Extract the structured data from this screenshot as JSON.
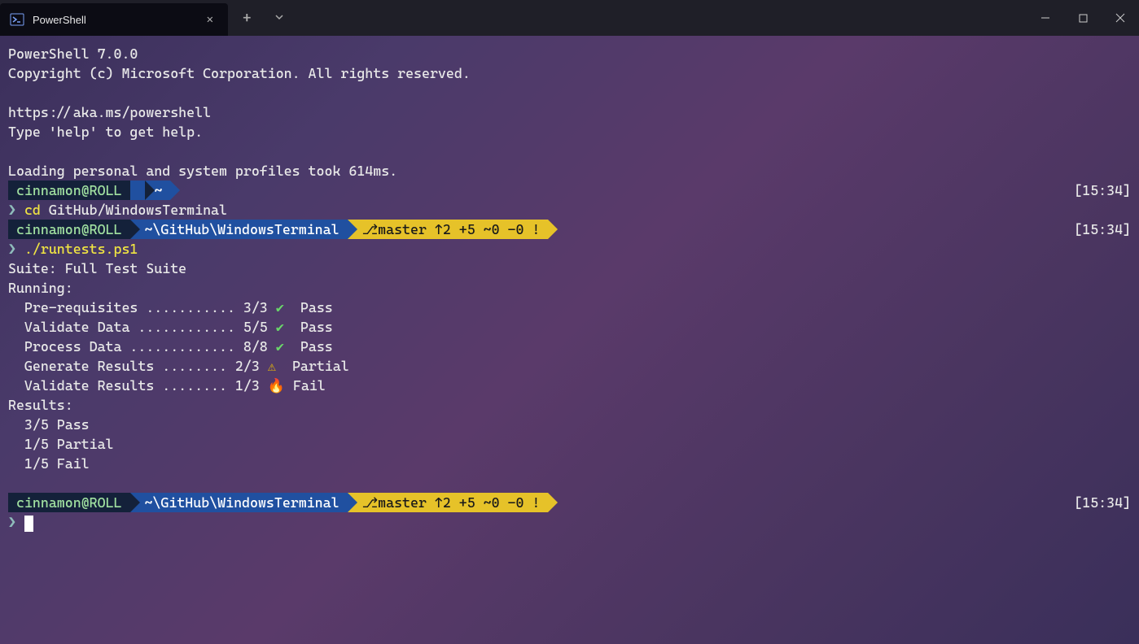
{
  "titlebar": {
    "tab_title": "PowerShell",
    "tab_icon": "powershell-icon"
  },
  "banner": {
    "line1": "PowerShell 7.0.0",
    "line2": "Copyright (c) Microsoft Corporation. All rights reserved.",
    "line3": "https://aka.ms/powershell",
    "line4": "Type 'help' to get help.",
    "line5": "Loading personal and system profiles took 614ms."
  },
  "prompt1": {
    "user": "cinnamon@ROLL",
    "path": "~",
    "time": "[15:34]"
  },
  "cmd1": {
    "caret": "❯",
    "cmd_name": "cd",
    "cmd_arg": "GitHub/WindowsTerminal"
  },
  "prompt2": {
    "user": "cinnamon@ROLL",
    "path": "~\\GitHub\\WindowsTerminal",
    "git": " master ↑2 +5 ~0 -0 !",
    "git_icon": "git-branch-icon",
    "time": "[15:34]"
  },
  "cmd2": {
    "caret": "❯",
    "cmd": "./runtests.ps1"
  },
  "suite": {
    "title": "Suite: Full Test Suite",
    "running": "Running:",
    "rows": [
      {
        "label": "  Pre-requisites ........... 3/3",
        "icon": "check-icon",
        "glyph": "✔",
        "status": "Pass"
      },
      {
        "label": "  Validate Data ............ 5/5",
        "icon": "check-icon",
        "glyph": "✔",
        "status": "Pass"
      },
      {
        "label": "  Process Data ............. 8/8",
        "icon": "check-icon",
        "glyph": "✔",
        "status": "Pass"
      },
      {
        "label": "  Generate Results ........ 2/3",
        "icon": "warning-icon",
        "glyph": "⚠",
        "status": "Partial"
      },
      {
        "label": "  Validate Results ........ 1/3",
        "icon": "fire-icon",
        "glyph": "🔥",
        "status": "Fail"
      }
    ],
    "results_header": "Results:",
    "results": [
      "  3/5 Pass",
      "  1/5 Partial",
      "  1/5 Fail"
    ]
  },
  "prompt3": {
    "user": "cinnamon@ROLL",
    "path": "~\\GitHub\\WindowsTerminal",
    "git": " master ↑2 +5 ~0 -0 !",
    "git_icon": "git-branch-icon",
    "time": "[15:34]"
  },
  "cmd3": {
    "caret": "❯"
  },
  "colors": {
    "user_bg": "#14213a",
    "path_bg": "#2050a0",
    "git_bg": "#e6c229",
    "user_fg": "#a0e0a0",
    "path_fg": "#ffffff",
    "git_fg": "#1a1a1a"
  }
}
